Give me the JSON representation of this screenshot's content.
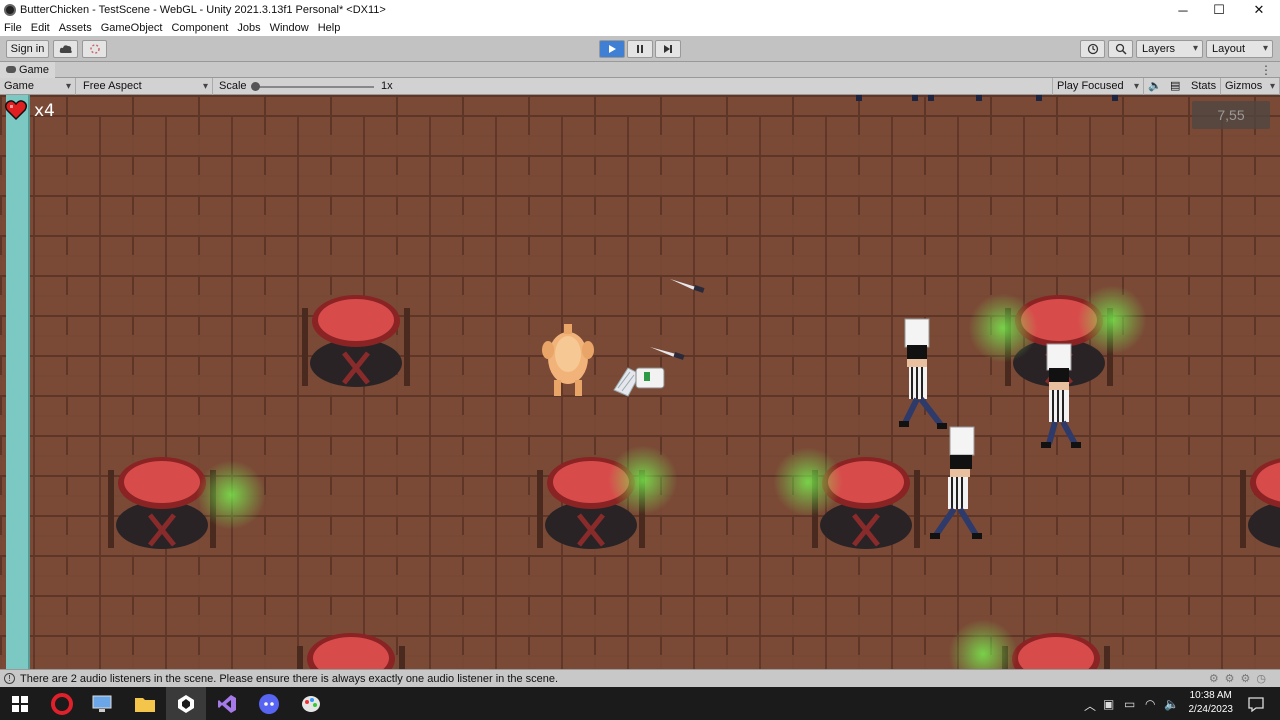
{
  "window": {
    "title": "ButterChicken - TestScene - WebGL - Unity 2021.3.13f1 Personal* <DX11>",
    "minimize": "─",
    "maximize": "☐",
    "close": "✕"
  },
  "menu": [
    "File",
    "Edit",
    "Assets",
    "GameObject",
    "Component",
    "Jobs",
    "Window",
    "Help"
  ],
  "toolbar": {
    "sign_in": "Sign in",
    "layers": "Layers",
    "layout": "Layout"
  },
  "tab": {
    "label": "Game"
  },
  "gamebar": {
    "display": "Game",
    "aspect": "Free Aspect",
    "scale_label": "Scale",
    "scale_value": "1x",
    "play_mode": "Play Focused",
    "stats": "Stats",
    "gizmos": "Gizmos"
  },
  "hud": {
    "lives": "x4",
    "timer": "7,55"
  },
  "status": {
    "message": "There are 2 audio listeners in the scene. Please ensure there is always exactly one audio listener in the scene."
  },
  "taskbar": {
    "time": "10:38 AM",
    "date": "2/24/2023"
  },
  "colors": {
    "play_active": "#3f7fd4",
    "floor": "#7a4a36",
    "health_bar": "#7cc9c4",
    "table_top": "#d84b4b",
    "glow": "#78ff50"
  }
}
